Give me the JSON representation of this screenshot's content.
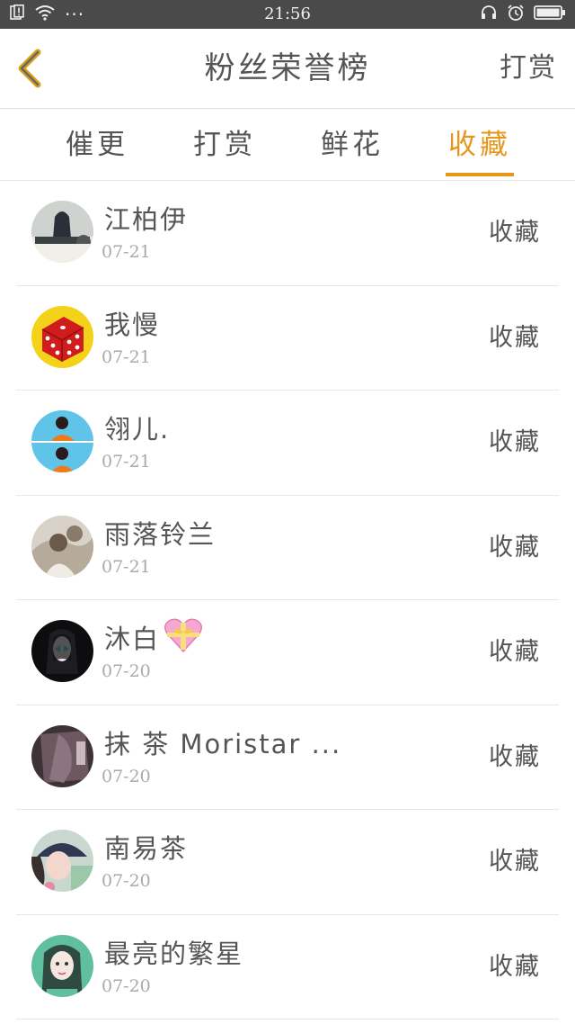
{
  "status_bar": {
    "time": "21:56",
    "dots": "···"
  },
  "header": {
    "title": "粉丝荣誉榜",
    "reward_button": "打赏",
    "back_icon": "chevron-left-icon"
  },
  "tabs": [
    {
      "label": "催更",
      "active": false
    },
    {
      "label": "打赏",
      "active": false
    },
    {
      "label": "鲜花",
      "active": false
    },
    {
      "label": "收藏",
      "active": true
    }
  ],
  "accent_color": "#e8961b",
  "fans": [
    {
      "name": "江柏伊",
      "date": "07-21",
      "action": "收藏"
    },
    {
      "name": "我慢",
      "date": "07-21",
      "action": "收藏"
    },
    {
      "name": "翎儿.",
      "date": "07-21",
      "action": "收藏"
    },
    {
      "name": "雨落铃兰",
      "date": "07-21",
      "action": "收藏"
    },
    {
      "name": "沐白",
      "date": "07-20",
      "action": "收藏",
      "emoji_icon": "heart-gift-icon"
    },
    {
      "name": "抹 茶 Moristar ...",
      "date": "07-20",
      "action": "收藏"
    },
    {
      "name": "南易茶",
      "date": "07-20",
      "action": "收藏"
    },
    {
      "name": "最亮的繁星",
      "date": "07-20",
      "action": "收藏"
    }
  ]
}
